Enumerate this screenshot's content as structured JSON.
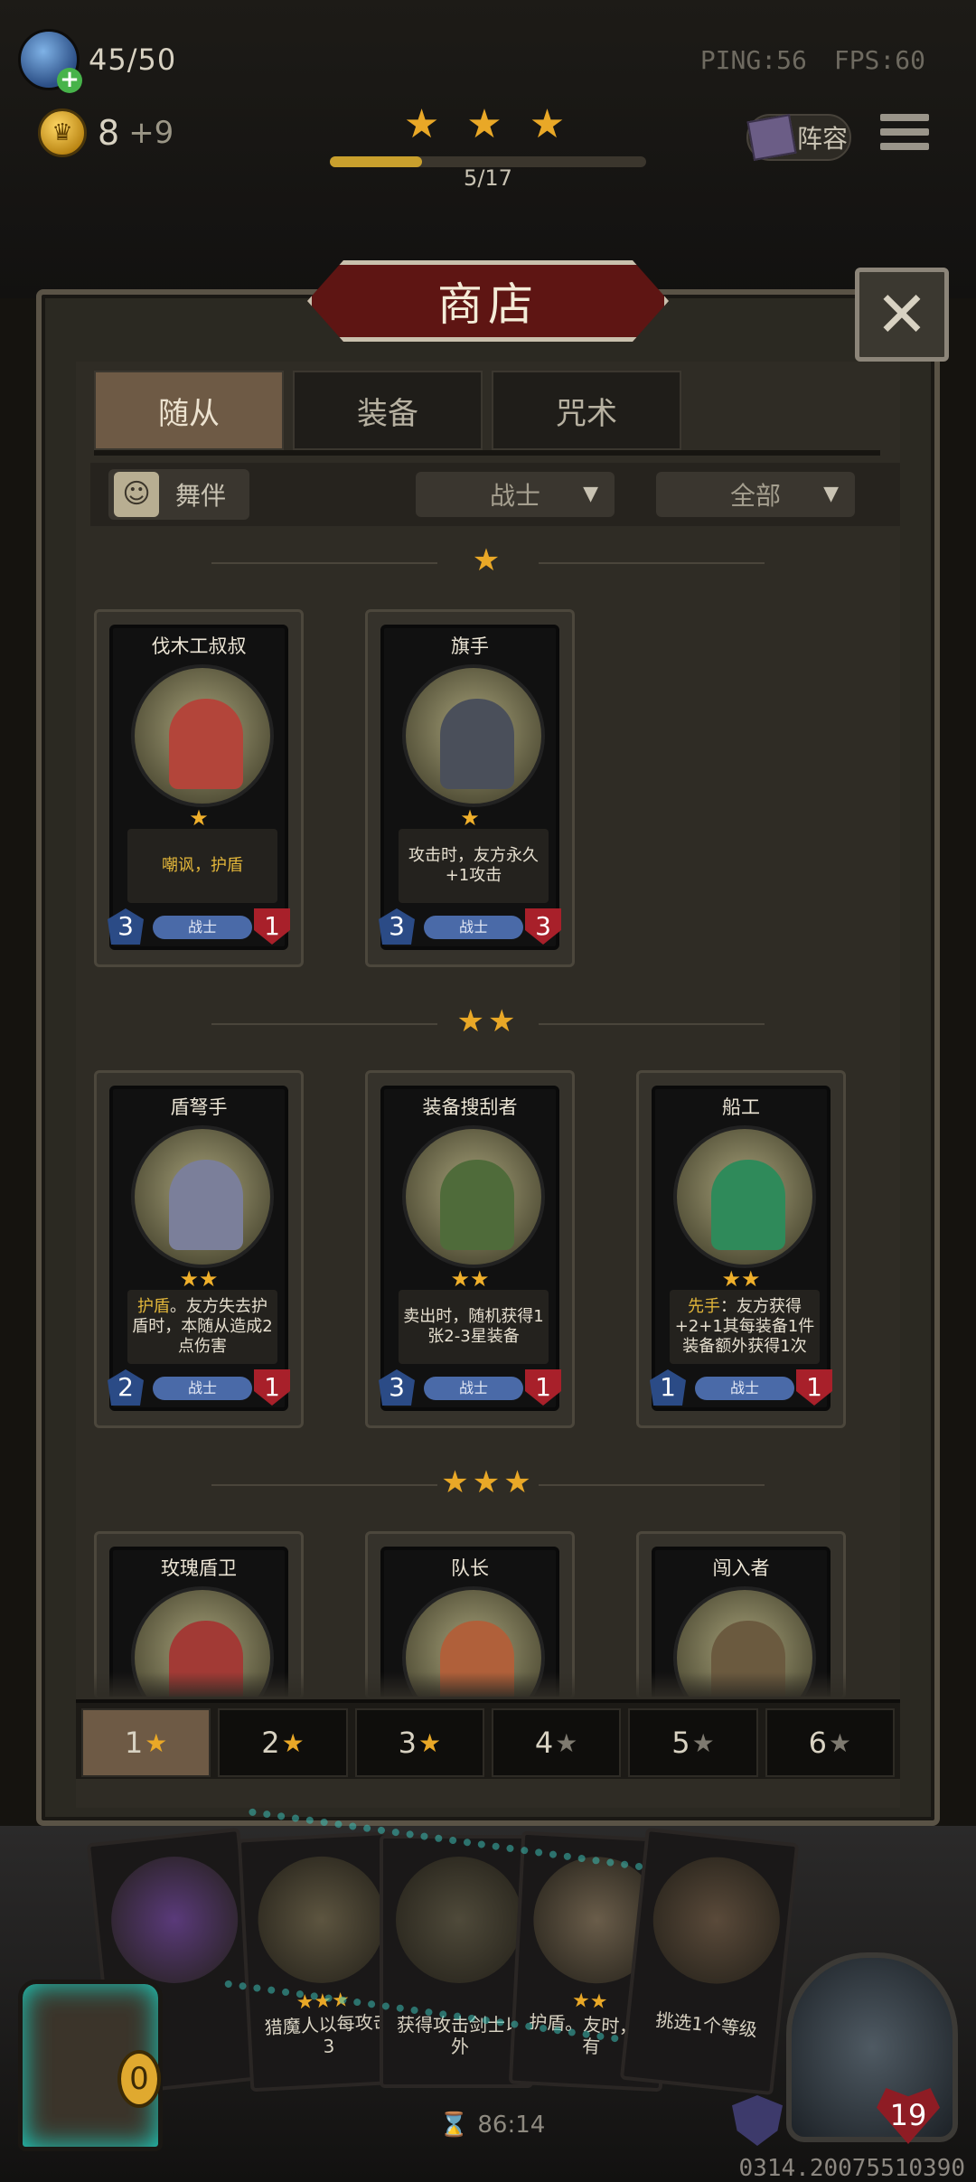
{
  "hud": {
    "health": "45/50",
    "gold": "8",
    "gold_income": "+9",
    "ping": "PING:56",
    "fps": "FPS:60",
    "roster_label": "阵容",
    "stage_stars": "★ ★ ★",
    "stage_progress_text": "5/17",
    "stage_progress": 0.29
  },
  "shop": {
    "title": "商店",
    "close_glyph": "✕",
    "tabs": [
      "随从",
      "装备",
      "咒术"
    ],
    "active_tab": 0,
    "filter_label": "舞伴",
    "dropdown_class": "战士",
    "dropdown_all": "全部"
  },
  "tiers": {
    "t1_stars": "★",
    "t2_stars": "★★",
    "t3_stars": "★★★"
  },
  "cards": [
    {
      "name": "伐木工叔叔",
      "stars": "★",
      "desc_hl": "嘲讽，护盾",
      "desc": "",
      "atk": "3",
      "hp": "1",
      "tribe": "战士",
      "color": "#b3453a"
    },
    {
      "name": "旗手",
      "stars": "★",
      "desc_hl": "",
      "desc": "攻击时，友方永久+1攻击",
      "atk": "3",
      "hp": "3",
      "tribe": "战士",
      "color": "#4a4f5a"
    },
    {
      "name": "盾弩手",
      "stars": "★★",
      "desc_hl": "护盾",
      "desc": "。友方失去护盾时，本随从造成2点伤害",
      "atk": "2",
      "hp": "1",
      "tribe": "战士",
      "color": "#7b7f9a"
    },
    {
      "name": "装备搜刮者",
      "stars": "★★",
      "desc_hl": "",
      "desc": "卖出时，随机获得1张2-3星装备",
      "atk": "3",
      "hp": "1",
      "tribe": "战士",
      "color": "#4f6b3a"
    },
    {
      "name": "船工",
      "stars": "★★",
      "desc_hl": "先手",
      "desc": "：友方获得+2+1其每装备1件装备额外获得1次",
      "atk": "1",
      "hp": "1",
      "tribe": "战士",
      "color": "#2f8a5a"
    },
    {
      "name": "玫瑰盾卫",
      "stars": "★★★",
      "desc_hl": "",
      "desc": "",
      "atk": "",
      "hp": "",
      "tribe": "",
      "color": "#a23a35"
    },
    {
      "name": "队长",
      "stars": "★★★",
      "desc_hl": "",
      "desc": "",
      "atk": "",
      "hp": "",
      "tribe": "",
      "color": "#b0603a"
    },
    {
      "name": "闯入者",
      "stars": "★★★",
      "desc_hl": "",
      "desc": "",
      "atk": "",
      "hp": "",
      "tribe": "",
      "color": "#6b5a3f"
    }
  ],
  "tier_tabs": [
    "1",
    "2",
    "3",
    "4",
    "5",
    "6"
  ],
  "active_tier_tab": 0,
  "bottom": {
    "hand": [
      {
        "stars": "",
        "text": "",
        "color": "#5a3a7a"
      },
      {
        "stars": "★★★",
        "text": "猎魔人以每攻击3",
        "color": "#5d5540"
      },
      {
        "stars": "",
        "text": "获得攻击剑士以外",
        "color": "#4f4a3a"
      },
      {
        "stars": "★★",
        "text": "护盾。友时，所有",
        "color": "#6a5d4a"
      },
      {
        "stars": "",
        "text": "挑选1个等级",
        "color": "#5a4a3a"
      }
    ],
    "chest_count": "0",
    "timer": "86:14",
    "hero_hp": "19",
    "session_id": "0314.20075510390"
  }
}
